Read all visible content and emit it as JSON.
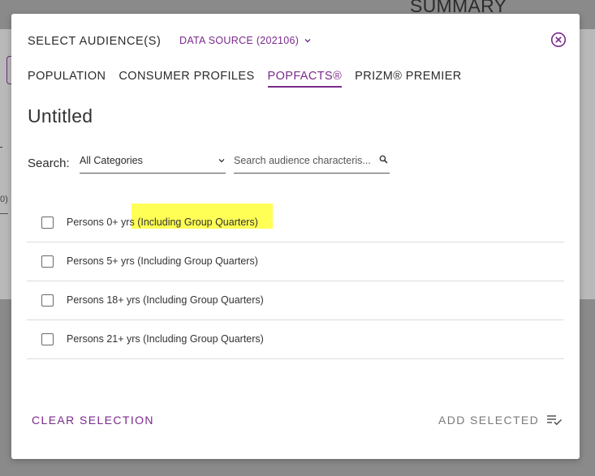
{
  "background": {
    "summary_heading": "SUMMARY",
    "fragment_paren": "0)"
  },
  "modal": {
    "title": "SELECT AUDIENCE(S)",
    "data_source_label": "DATA SOURCE (202106)",
    "tabs": [
      {
        "label": "POPULATION",
        "active": false
      },
      {
        "label": "CONSUMER PROFILES",
        "active": false
      },
      {
        "label": "POPFACTS®",
        "active": true
      },
      {
        "label": "PRIZM® PREMIER",
        "active": false
      }
    ],
    "audience_name": "Untitled",
    "search": {
      "label": "Search:",
      "category_value": "All Categories",
      "placeholder": "Search audience characteris..."
    },
    "items": [
      {
        "label": "Persons 0+ yrs (Including Group Quarters)",
        "checked": false,
        "highlighted": true
      },
      {
        "label": "Persons 5+ yrs (Including Group Quarters)",
        "checked": false
      },
      {
        "label": "Persons 18+ yrs (Including Group Quarters)",
        "checked": false
      },
      {
        "label": "Persons 21+ yrs (Including Group Quarters)",
        "checked": false
      }
    ],
    "clear_selection_label": "CLEAR SELECTION",
    "add_selected_label": "ADD SELECTED"
  },
  "colors": {
    "accent": "#7a2a8c",
    "highlight": "#ffff55",
    "overlay": "#8a8a8a"
  }
}
